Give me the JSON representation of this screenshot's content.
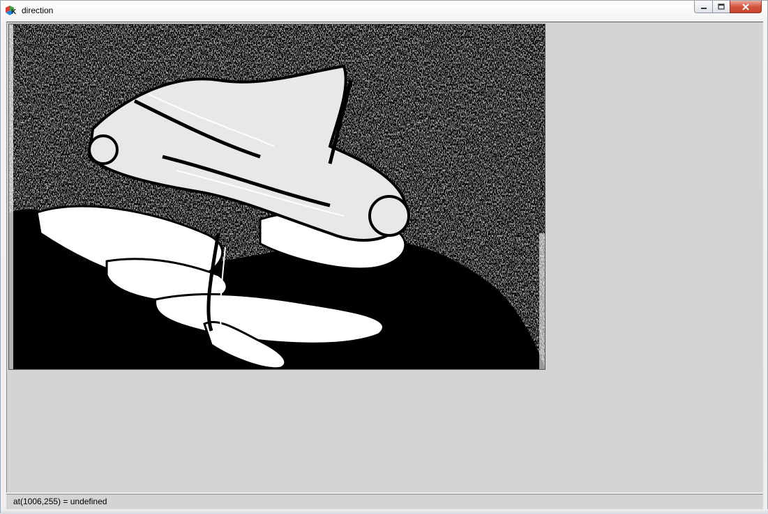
{
  "window": {
    "title": "direction",
    "app_icon": "gtk-logo-icon",
    "controls": [
      "minimize-icon",
      "maximize-icon",
      "close-icon"
    ]
  },
  "image": {
    "description_icon": "edge-direction-image"
  },
  "status": {
    "text": "at(1006,255) = undefined"
  },
  "colors": {
    "client_bg": "#d4d4d4",
    "image_dark": "#000000",
    "image_light": "#ffffff",
    "close_red": "#c4422a"
  }
}
